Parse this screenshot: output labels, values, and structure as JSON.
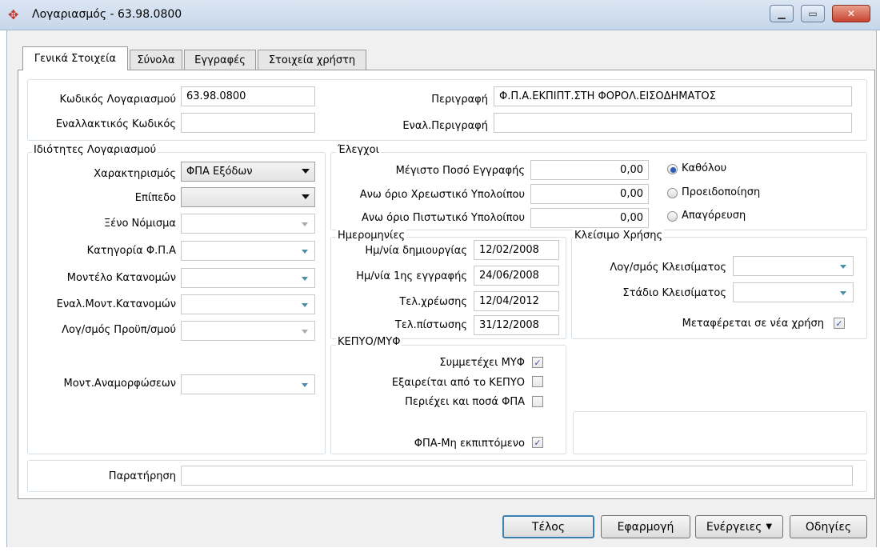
{
  "window": {
    "title": "Λογαριασμός - 63.98.0800"
  },
  "tabs": [
    {
      "label": "Γενικά Στοιχεία"
    },
    {
      "label": "Σύνολα"
    },
    {
      "label": "Εγγραφές"
    },
    {
      "label": "Στοιχεία χρήστη"
    }
  ],
  "header": {
    "code_label": "Κωδικός Λογαριασμού",
    "code_value": "63.98.0800",
    "alt_code_label": "Εναλλακτικός Κωδικός",
    "alt_code_value": "",
    "desc_label": "Περιγραφή",
    "desc_value": "Φ.Π.Α.ΕΚΠΙΠΤ.ΣΤΗ ΦΟΡΟΛ.ΕΙΣΟΔΗΜΑΤΟΣ",
    "alt_desc_label": "Εναλ.Περιγραφή",
    "alt_desc_value": ""
  },
  "properties": {
    "title": "Ιδιότητες Λογαριασμού",
    "characterization_label": "Χαρακτηρισμός",
    "characterization_value": "ΦΠΑ Εξόδων",
    "level_label": "Επίπεδο",
    "level_value": "",
    "currency_label": "Ξένο Νόμισμα",
    "vat_category_label": "Κατηγορία Φ.Π.Α",
    "alloc_model_label": "Μοντέλο Κατανομών",
    "alt_alloc_model_label": "Εναλ.Μοντ.Κατανομών",
    "budget_account_label": "Λογ/σμός Προϋπ/σμού",
    "reform_model_label": "Μοντ.Αναμορφώσεων"
  },
  "checks": {
    "title": "Έλεγχοι",
    "max_amount_label": "Μέγιστο Ποσό Εγγραφής",
    "max_amount_value": "0,00",
    "debit_limit_label": "Ανω όριο Χρεωστικό Υπολοίπου",
    "debit_limit_value": "0,00",
    "credit_limit_label": "Ανω όριο Πιστωτικό Υπολοίπου",
    "credit_limit_value": "0,00",
    "radio_none": "Καθόλου",
    "radio_warning": "Προειδοποίηση",
    "radio_block": "Απαγόρευση"
  },
  "dates": {
    "title": "Ημερομηνίες",
    "created_label": "Ημ/νία δημιουργίας",
    "created_value": "12/02/2008",
    "first_entry_label": "Ημ/νία 1ης εγγραφής",
    "first_entry_value": "24/06/2008",
    "last_debit_label": "Τελ.χρέωσης",
    "last_debit_value": "12/04/2012",
    "last_credit_label": "Τελ.πίστωσης",
    "last_credit_value": "31/12/2008"
  },
  "closing": {
    "title": "Κλείσιμο Χρήσης",
    "closing_account_label": "Λογ/σμός Κλεισίματος",
    "closing_stage_label": "Στάδιο Κλεισίματος",
    "carry_forward_label": "Μεταφέρεται σε νέα χρήση",
    "carry_forward_checked": true
  },
  "kepyo": {
    "title": "ΚΕΠΥΟ/ΜΥΦ",
    "myf_label": "Συμμετέχει ΜΥΦ",
    "myf_checked": true,
    "excluded_label": "Εξαιρείται από το ΚΕΠΥΟ",
    "excluded_checked": false,
    "vat_amounts_label": "Περιέχει και ποσά ΦΠΑ",
    "vat_amounts_checked": false,
    "non_deductible_label": "ΦΠΑ-Μη εκπιπτόμενο",
    "non_deductible_checked": true
  },
  "remarks": {
    "label": "Παρατήρηση",
    "value": ""
  },
  "buttons": {
    "end": "Τέλος",
    "apply": "Εφαρμογή",
    "actions": "Ενέργειες",
    "instructions": "Οδηγίες"
  },
  "colors": {
    "accent": "#3c7fb1",
    "checkmark": "#3a56a8"
  }
}
